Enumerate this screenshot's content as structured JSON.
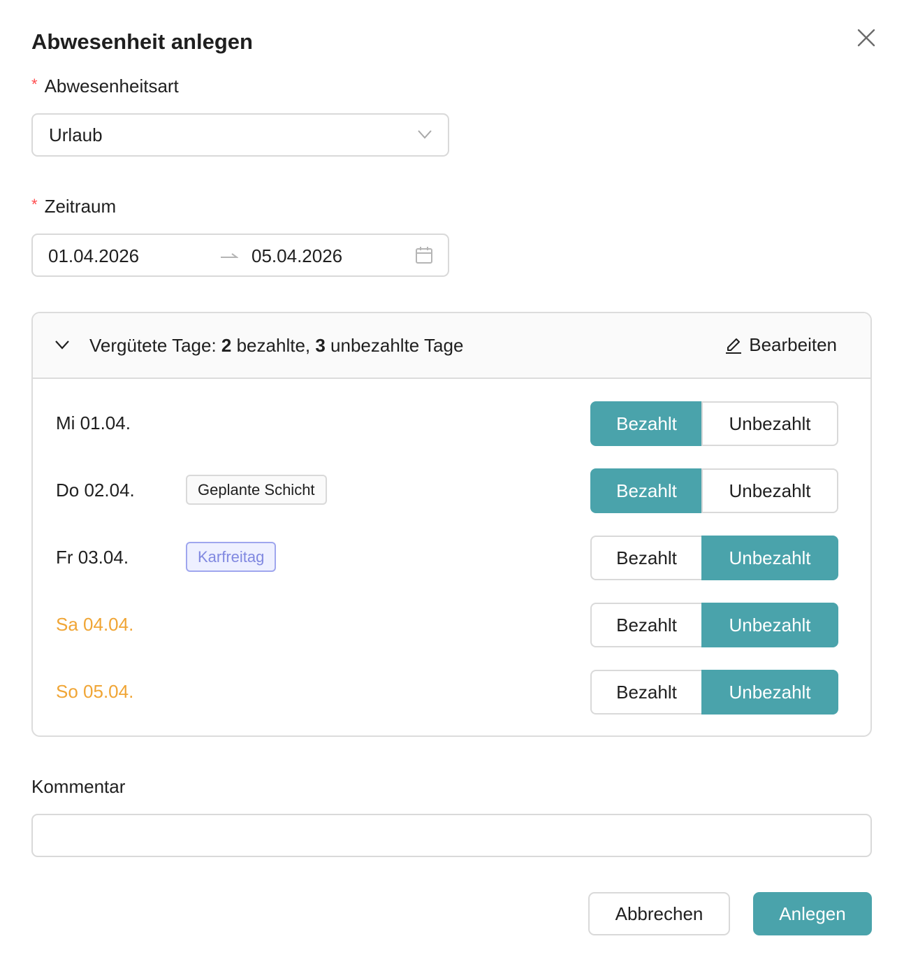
{
  "modal": {
    "title": "Abwesenheit anlegen"
  },
  "absence_type": {
    "required_mark": "*",
    "label": "Abwesenheitsart",
    "value": "Urlaub"
  },
  "period": {
    "required_mark": "*",
    "label": "Zeitraum",
    "from": "01.04.2026",
    "to": "05.04.2026"
  },
  "paid_days": {
    "summary_prefix": "Vergütete Tage: ",
    "paid_count": "2",
    "paid_text": " bezahlte, ",
    "unpaid_count": "3",
    "unpaid_text": " unbezahlte Tage",
    "edit_label": "Bearbeiten",
    "paid_option": "Bezahlt",
    "unpaid_option": "Unbezahlt",
    "days": [
      {
        "date": "Mi 01.04.",
        "tag": "",
        "tag_type": "",
        "weekend": false,
        "selected": "paid"
      },
      {
        "date": "Do 02.04.",
        "tag": "Geplante Schicht",
        "tag_type": "shift",
        "weekend": false,
        "selected": "paid"
      },
      {
        "date": "Fr 03.04.",
        "tag": "Karfreitag",
        "tag_type": "holiday",
        "weekend": false,
        "selected": "unpaid"
      },
      {
        "date": "Sa 04.04.",
        "tag": "",
        "tag_type": "",
        "weekend": true,
        "selected": "unpaid"
      },
      {
        "date": "So 05.04.",
        "tag": "",
        "tag_type": "",
        "weekend": true,
        "selected": "unpaid"
      }
    ]
  },
  "comment": {
    "label": "Kommentar",
    "value": "",
    "placeholder": ""
  },
  "footer": {
    "cancel_label": "Abbrechen",
    "submit_label": "Anlegen"
  },
  "colors": {
    "accent": "#4aa3ab",
    "required": "#ff4d4f",
    "weekend": "#f0a535",
    "holiday_tag": "#8088e0"
  },
  "icons": {
    "close": "close-icon",
    "select": "chevron-down-icon",
    "range_arrow": "arrow-right-icon",
    "calendar": "calendar-icon",
    "collapse": "chevron-down-icon",
    "edit": "pencil-icon"
  }
}
